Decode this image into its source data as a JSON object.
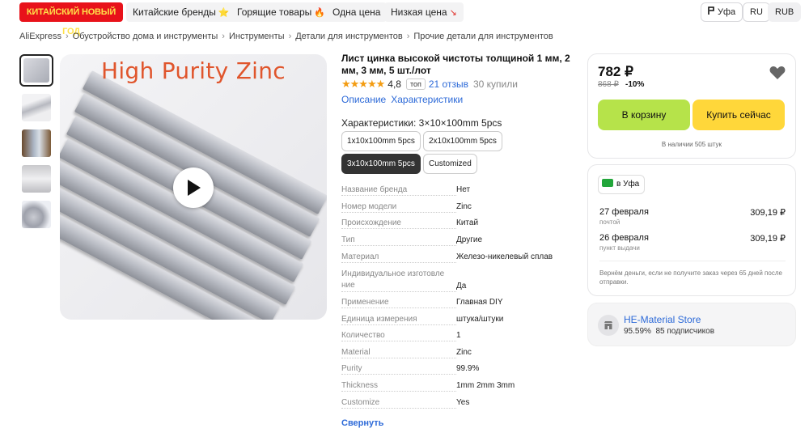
{
  "topbar": {
    "promo": "КИТАЙСКИЙ НОВЫЙ ГОД",
    "pills": [
      {
        "label": "Китайские бренды",
        "emoji": "⭐"
      },
      {
        "label": "Горящие товары",
        "emoji": "🔥"
      },
      {
        "label": "Одна цена",
        "emoji": ""
      },
      {
        "label": "Низкая цена",
        "emoji": "↘"
      }
    ],
    "city": "Уфа",
    "lang": "RU",
    "currency": "RUB"
  },
  "breadcrumb": [
    "AliExpress",
    "Обустройство дома и инструменты",
    "Инструменты",
    "Детали для инструментов",
    "Прочие детали для инструментов"
  ],
  "gallery": {
    "image_caption": "High Purity Zinc",
    "thumb_count": 5
  },
  "product": {
    "title": "Лист цинка высокой чистоты толщиной 1 мм, 2 мм, 3 мм, 5 шт./лот",
    "stars": "★★★★★",
    "rating": "4,8",
    "top_badge": "топ",
    "reviews": "21 отзыв",
    "bought": "30 купили",
    "tabs": [
      "Описание",
      "Характеристики"
    ],
    "characteristic_label": "Характеристики: 3×10×100mm 5pcs",
    "options": [
      "1x10x100mm 5pcs",
      "2x10x100mm 5pcs",
      "3x10x100mm 5pcs",
      "Customized"
    ],
    "selected_option": 2,
    "specs": [
      {
        "k": "Название бренда",
        "v": "Нет"
      },
      {
        "k": "Номер модели",
        "v": "Zinc"
      },
      {
        "k": "Происхождение",
        "v": "Китай"
      },
      {
        "k": "Тип",
        "v": "Другие"
      },
      {
        "k": "Материал",
        "v": "Железо-никелевый сплав"
      },
      {
        "k": "Индивидуальное изготовле",
        "k2": "ние",
        "v": "Да"
      },
      {
        "k": "Применение",
        "v": "Главная DIY"
      },
      {
        "k": "Единица измерения",
        "v": "штука/штуки"
      },
      {
        "k": "Количество",
        "v": "1"
      },
      {
        "k": "Material",
        "v": "Zinc"
      },
      {
        "k": "Purity",
        "v": "99.9%"
      },
      {
        "k": "Thickness",
        "v": "1mm 2mm 3mm"
      },
      {
        "k": "Customize",
        "v": "Yes"
      }
    ],
    "collapse_label": "Свернуть"
  },
  "buy": {
    "price": "782 ₽",
    "old_price": "868 ₽",
    "discount": "-10%",
    "cart_label": "В корзину",
    "buy_label": "Купить сейчас",
    "stock": "В наличии 505 штук"
  },
  "delivery": {
    "badge": "в Уфа",
    "lines": [
      {
        "date": "27 февраля",
        "sub": "почтой",
        "price": "309,19 ₽"
      },
      {
        "date": "26 февраля",
        "sub": "пункт выдачи",
        "price": "309,19 ₽"
      }
    ],
    "refund": "Вернём деньги, если не получите заказ через 65 дней после отправки."
  },
  "store": {
    "name": "HE-Material Store",
    "rating": "95.59%",
    "followers": "85 подписчиков"
  },
  "colors": {
    "promo_bg": "#e8121a",
    "cart": "#b6e34a",
    "buy": "#ffd73a",
    "link": "#2d6ad8",
    "star": "#f39c12"
  }
}
